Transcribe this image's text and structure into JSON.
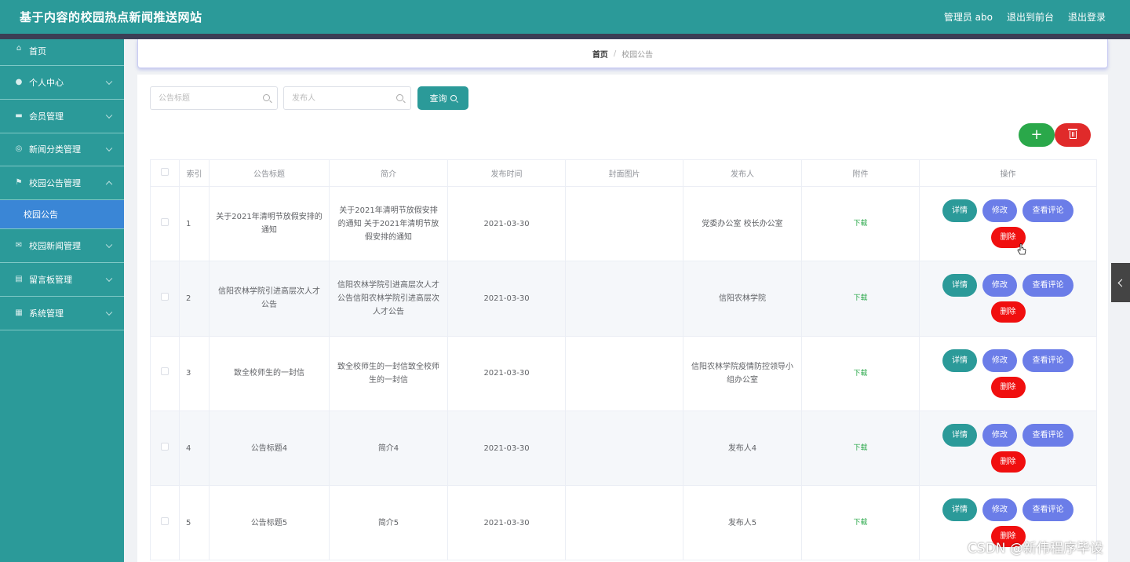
{
  "header": {
    "title": "基于内容的校园热点新闻推送网站",
    "admin": "管理员 abo",
    "to_front": "退出到前台",
    "logout": "退出登录"
  },
  "sidebar": {
    "items": [
      {
        "label": "首页",
        "icon": "home-icon"
      },
      {
        "label": "个人中心",
        "icon": "user-icon"
      },
      {
        "label": "会员管理",
        "icon": "monitor-icon"
      },
      {
        "label": "新闻分类管理",
        "icon": "compass-icon"
      },
      {
        "label": "校园公告管理",
        "icon": "flag-icon"
      },
      {
        "label": "校园新闻管理",
        "icon": "mail-icon"
      },
      {
        "label": "留言板管理",
        "icon": "board-icon"
      },
      {
        "label": "系统管理",
        "icon": "grid-icon"
      }
    ],
    "sub_active": "校园公告"
  },
  "breadcrumb": {
    "home": "首页",
    "separator": "/",
    "current": "校园公告"
  },
  "search": {
    "title_placeholder": "公告标题",
    "publisher_placeholder": "发布人",
    "query_label": "查询"
  },
  "actions": {
    "add_symbol": "+"
  },
  "table": {
    "columns": [
      "索引",
      "公告标题",
      "简介",
      "发布时间",
      "封面图片",
      "发布人",
      "附件",
      "操作"
    ],
    "download_label": "下载",
    "buttons": {
      "detail": "详情",
      "edit": "修改",
      "comments": "查看评论",
      "delete": "删除"
    },
    "rows": [
      {
        "index": "1",
        "title": "关于2021年清明节放假安排的通知",
        "summary": "关于2021年清明节放假安排的通知 关于2021年清明节放假安排的通知",
        "date": "2021-03-30",
        "cover": "",
        "publisher": "党委办公室 校长办公室"
      },
      {
        "index": "2",
        "title": "信阳农林学院引进高层次人才公告",
        "summary": "信阳农林学院引进高层次人才公告信阳农林学院引进高层次人才公告",
        "date": "2021-03-30",
        "cover": "",
        "publisher": "信阳农林学院"
      },
      {
        "index": "3",
        "title": "致全校师生的一封信",
        "summary": "致全校师生的一封信致全校师生的一封信",
        "date": "2021-03-30",
        "cover": "",
        "publisher": "信阳农林学院疫情防控领导小组办公室"
      },
      {
        "index": "4",
        "title": "公告标题4",
        "summary": "简介4",
        "date": "2021-03-30",
        "cover": "",
        "publisher": "发布人4"
      },
      {
        "index": "5",
        "title": "公告标题5",
        "summary": "简介5",
        "date": "2021-03-30",
        "cover": "",
        "publisher": "发布人5"
      }
    ]
  },
  "watermark": "CSDN @新伟程序毕设",
  "colors": {
    "primary": "#2b9a99",
    "accent_blue": "#6b7de8",
    "danger": "#f00f0f",
    "success": "#2aa84a",
    "active_sub": "#3a86d6"
  }
}
